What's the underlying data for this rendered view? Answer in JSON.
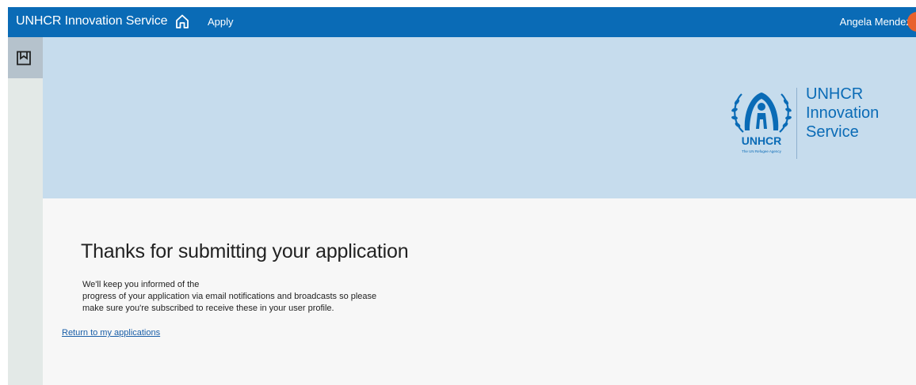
{
  "topbar": {
    "app_title": "UNHCR Innovation Service",
    "home_icon": "home-icon",
    "apply_label": "Apply",
    "user_name": "Angela Mendez",
    "background": "#0a6bb6",
    "avatar_color": "#e8612c"
  },
  "sidebar": {
    "bookmark_icon": "bookmark-icon"
  },
  "banner": {
    "background": "#c6dced",
    "logo": {
      "emblem_wordmark": "UNHCR",
      "emblem_tagline": "The UN Refugee Agency",
      "title_lines": [
        "UNHCR",
        "Innovation",
        "Service"
      ]
    }
  },
  "main": {
    "heading": "Thanks for submitting your application",
    "message_lines": [
      "We'll keep you informed of the",
      "progress of your application via email notifications and broadcasts so please",
      "make sure you're subscribed to receive these in your user profile."
    ],
    "return_link": "Return to my applications"
  }
}
